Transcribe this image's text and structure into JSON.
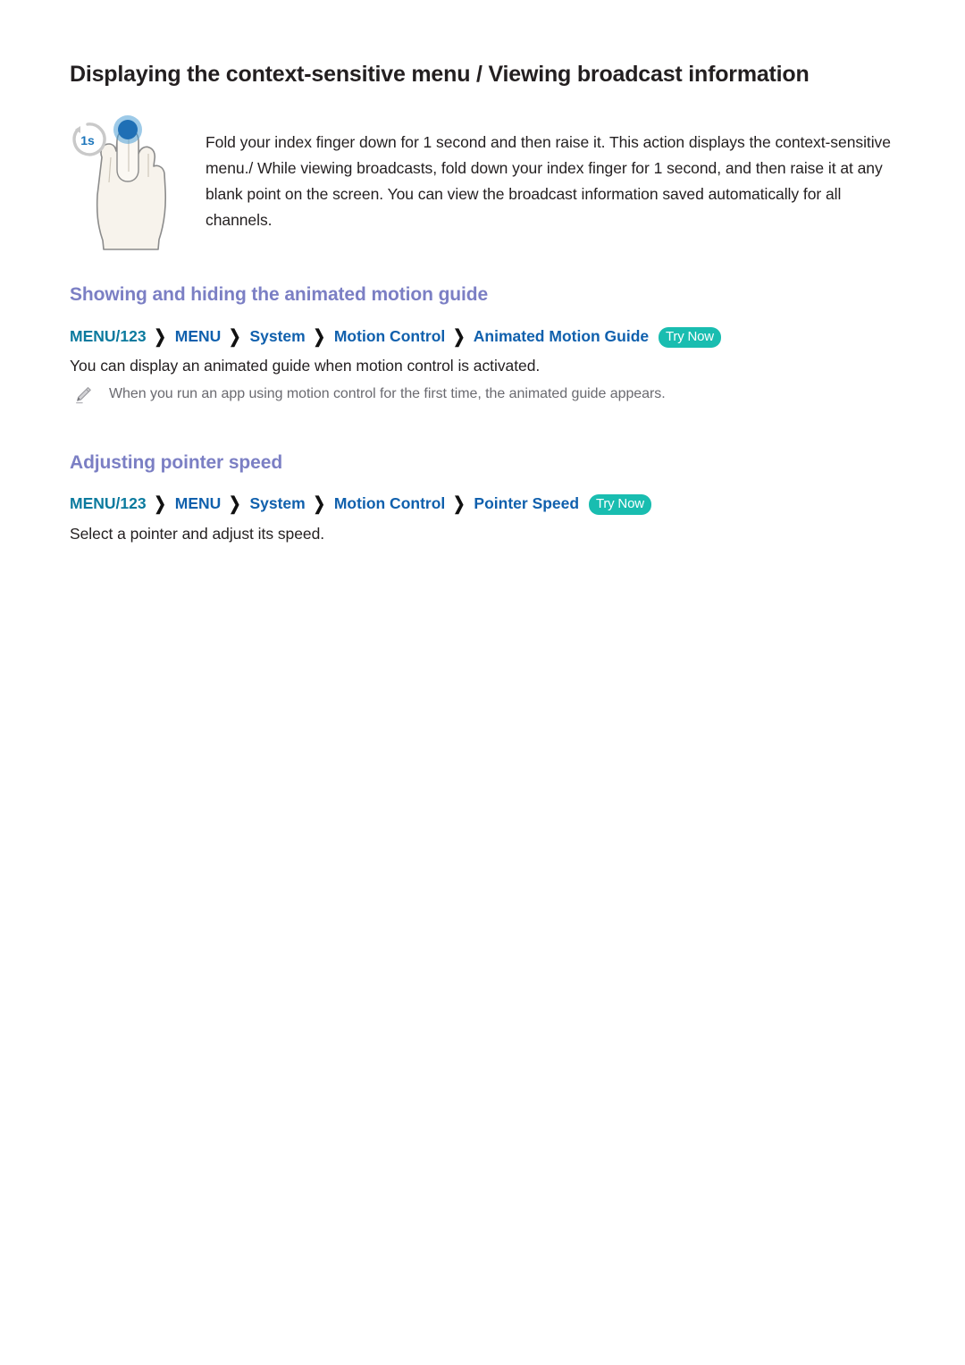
{
  "page": {
    "title": "Displaying the context-sensitive menu / Viewing broadcast information",
    "background_color": "#ffffff"
  },
  "intro": {
    "figure": {
      "icon_name": "fold-index-finger-hand-illustration",
      "timer_badge": "1s",
      "badge_text_color": "#1b75bb",
      "hand_fill": "#f7f3ec",
      "hand_outline": "#8c8c8c",
      "fingertip_dot_color": "#2f7ec4"
    },
    "paragraph": "Fold your index finger down for 1 second and then raise it. This action displays the context-sensitive menu./ While viewing broadcasts, fold down your index finger for 1 second, and then raise it at any blank point on the screen. You can view the broadcast information saved automatically for all channels."
  },
  "sections": [
    {
      "heading": "Showing and hiding the animated motion guide",
      "heading_color": "#7b7fc4",
      "breadcrumb": {
        "first": "MENU/123",
        "first_color": "#0b7a9e",
        "segments": [
          "MENU",
          "System",
          "Motion Control",
          "Animated Motion Guide"
        ],
        "segment_color": "#1060ad",
        "arrow": "❯",
        "try_now_label": "Try Now",
        "try_now_color": "#19bdb0"
      },
      "description": "You can display an animated guide when motion control is activated.",
      "note": {
        "icon_name": "pencil-icon",
        "text": "When you run an app using motion control for the first time, the animated guide appears."
      }
    },
    {
      "heading": "Adjusting pointer speed",
      "heading_color": "#7b7fc4",
      "breadcrumb": {
        "first": "MENU/123",
        "first_color": "#0b7a9e",
        "segments": [
          "MENU",
          "System",
          "Motion Control",
          "Pointer Speed"
        ],
        "segment_color": "#1060ad",
        "arrow": "❯",
        "try_now_label": "Try Now",
        "try_now_color": "#19bdb0"
      },
      "description": "Select a pointer and adjust its speed."
    }
  ]
}
